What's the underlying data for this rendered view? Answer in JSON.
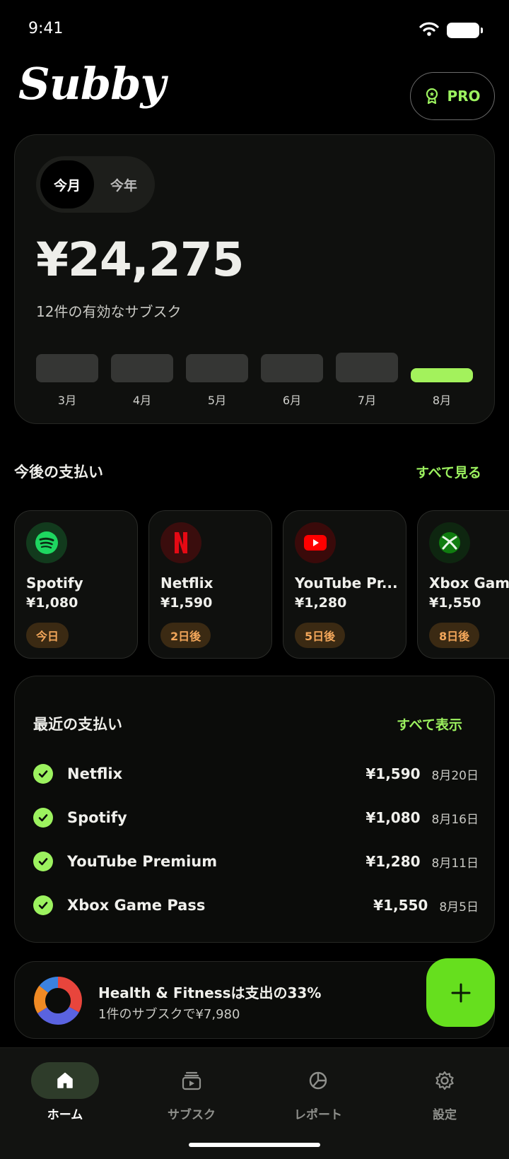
{
  "status": {
    "time": "9:41"
  },
  "app": {
    "logo": "Subby",
    "pro_label": "PRO"
  },
  "summary": {
    "tabs": [
      {
        "label": "今月",
        "active": true
      },
      {
        "label": "今年",
        "active": false
      }
    ],
    "amount": "¥24,275",
    "count_text": "12件の有効なサブスク",
    "months": [
      {
        "label": "3月",
        "level": 0.35
      },
      {
        "label": "4月",
        "level": 0.35
      },
      {
        "label": "5月",
        "level": 0.35
      },
      {
        "label": "6月",
        "level": 0.35
      },
      {
        "label": "7月",
        "level": 0.37
      },
      {
        "label": "8月",
        "level": 0.18,
        "current": true
      }
    ]
  },
  "upcoming": {
    "title": "今後の支払い",
    "see_all": "すべて見る",
    "items": [
      {
        "name": "Spotify",
        "price": "¥1,080",
        "badge": "今日",
        "icon": "spotify-icon"
      },
      {
        "name": "Netflix",
        "price": "¥1,590",
        "badge": "2日後",
        "icon": "netflix-icon"
      },
      {
        "name": "YouTube Pr...",
        "price": "¥1,280",
        "badge": "5日後",
        "icon": "youtube-icon"
      },
      {
        "name": "Xbox Game",
        "price": "¥1,550",
        "badge": "8日後",
        "icon": "xbox-icon"
      }
    ]
  },
  "recent": {
    "title": "最近の支払い",
    "see_all": "すべて表示",
    "rows": [
      {
        "name": "Netflix",
        "price": "¥1,590",
        "date": "8月20日"
      },
      {
        "name": "Spotify",
        "price": "¥1,080",
        "date": "8月16日"
      },
      {
        "name": "YouTube Premium",
        "price": "¥1,280",
        "date": "8月11日"
      },
      {
        "name": "Xbox Game Pass",
        "price": "¥1,550",
        "date": "8月5日"
      }
    ]
  },
  "insight": {
    "title": "Health & Fitnessは支出の33%",
    "subtitle": "1件のサブスクで¥7,980"
  },
  "nav": [
    {
      "label": "ホーム",
      "icon": "home-icon",
      "active": true
    },
    {
      "label": "サブスク",
      "icon": "subscriptions-icon",
      "active": false
    },
    {
      "label": "レポート",
      "icon": "report-icon",
      "active": false
    },
    {
      "label": "設定",
      "icon": "settings-icon",
      "active": false
    }
  ],
  "colors": {
    "accent": "#9cf25f",
    "fab": "#66df1e",
    "badge_text": "#f2a65a"
  }
}
